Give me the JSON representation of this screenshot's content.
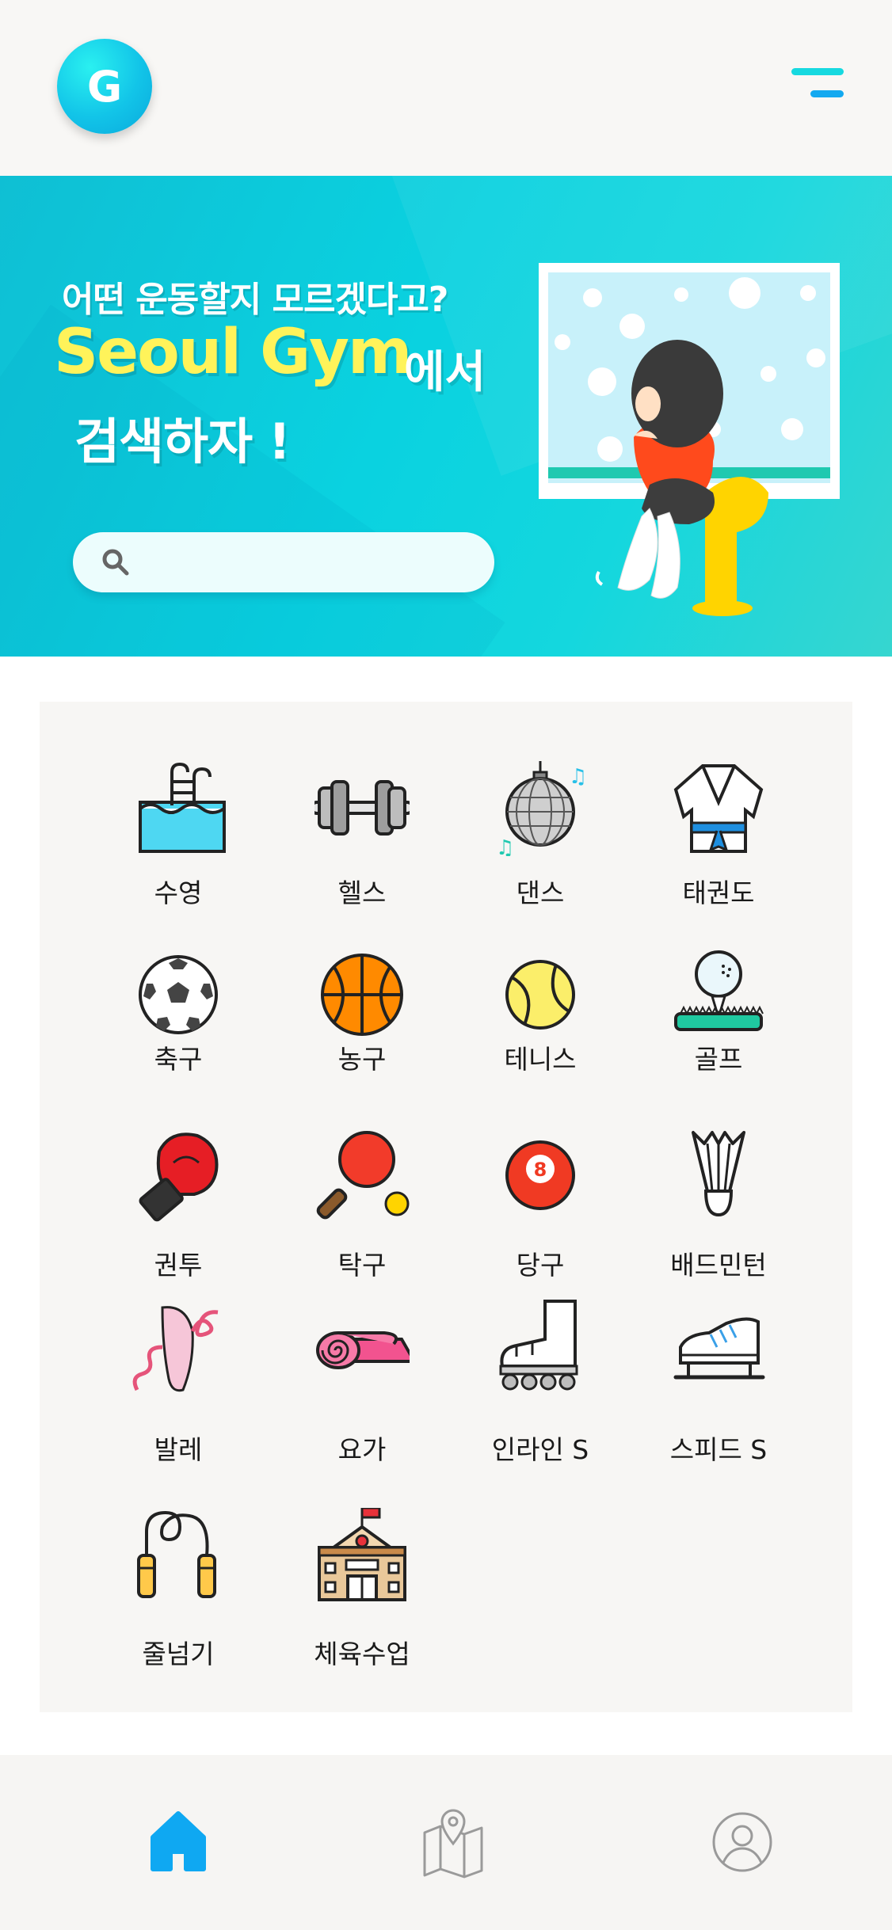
{
  "header": {
    "logo_letter": "G"
  },
  "banner": {
    "line1": "어떤 운동할지 모르겠다고?",
    "brand": "Seoul Gym",
    "suffix": "에서",
    "line3": "검색하자 !",
    "search_placeholder": ""
  },
  "categories": [
    {
      "label": "수영",
      "icon": "swimming-icon"
    },
    {
      "label": "헬스",
      "icon": "dumbbell-icon"
    },
    {
      "label": "댄스",
      "icon": "disco-ball-icon"
    },
    {
      "label": "태권도",
      "icon": "taekwondo-uniform-icon"
    },
    {
      "label": "축구",
      "icon": "soccer-ball-icon"
    },
    {
      "label": "농구",
      "icon": "basketball-icon"
    },
    {
      "label": "테니스",
      "icon": "tennis-ball-icon"
    },
    {
      "label": "골프",
      "icon": "golf-ball-icon"
    },
    {
      "label": "권투",
      "icon": "boxing-glove-icon"
    },
    {
      "label": "탁구",
      "icon": "ping-pong-icon"
    },
    {
      "label": "당구",
      "icon": "billiard-ball-icon"
    },
    {
      "label": "배드민턴",
      "icon": "shuttlecock-icon"
    },
    {
      "label": "발레",
      "icon": "ballet-shoe-icon"
    },
    {
      "label": "요가",
      "icon": "yoga-mat-icon"
    },
    {
      "label": "인라인 S",
      "icon": "inline-skate-icon"
    },
    {
      "label": "스피드 S",
      "icon": "speed-skate-icon"
    },
    {
      "label": "줄넘기",
      "icon": "jump-rope-icon"
    },
    {
      "label": "체육수업",
      "icon": "school-building-icon"
    }
  ],
  "nav": {
    "items": [
      {
        "name": "home",
        "icon": "home-icon",
        "active": true
      },
      {
        "name": "map",
        "icon": "map-icon",
        "active": false
      },
      {
        "name": "profile",
        "icon": "user-icon",
        "active": false
      }
    ]
  },
  "colors": {
    "accent": "#0fa8f2",
    "banner": "#0ad2e0",
    "brand_text": "#fff35a"
  }
}
